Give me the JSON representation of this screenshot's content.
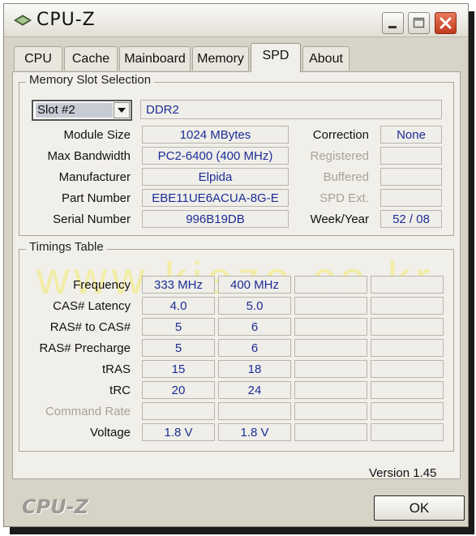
{
  "window": {
    "title": "CPU-Z",
    "controls": {
      "minimize": "minimize",
      "maximize": "maximize",
      "close": "close"
    }
  },
  "tabs": [
    {
      "label": "CPU"
    },
    {
      "label": "Cache"
    },
    {
      "label": "Mainboard"
    },
    {
      "label": "Memory"
    },
    {
      "label": "SPD",
      "active": true
    },
    {
      "label": "About"
    }
  ],
  "slot_selection": {
    "title": "Memory Slot Selection",
    "slot": "Slot #2",
    "type": "DDR2",
    "module_size_label": "Module Size",
    "module_size": "1024 MBytes",
    "max_bandwidth_label": "Max Bandwidth",
    "max_bandwidth": "PC2-6400 (400 MHz)",
    "manufacturer_label": "Manufacturer",
    "manufacturer": "Elpida",
    "part_number_label": "Part Number",
    "part_number": "EBE11UE6ACUA-8G-E",
    "serial_number_label": "Serial Number",
    "serial_number": "996B19DB",
    "correction_label": "Correction",
    "correction": "None",
    "registered_label": "Registered",
    "registered": "",
    "buffered_label": "Buffered",
    "buffered": "",
    "spd_ext_label": "SPD Ext.",
    "spd_ext": "",
    "week_year_label": "Week/Year",
    "week_year": "52 / 08"
  },
  "timings": {
    "title": "Timings Table",
    "rows": [
      {
        "label": "Frequency",
        "values": [
          "333 MHz",
          "400 MHz",
          "",
          ""
        ],
        "dim": false
      },
      {
        "label": "CAS# Latency",
        "values": [
          "4.0",
          "5.0",
          "",
          ""
        ],
        "dim": false
      },
      {
        "label": "RAS# to CAS#",
        "values": [
          "5",
          "6",
          "",
          ""
        ],
        "dim": false
      },
      {
        "label": "RAS# Precharge",
        "values": [
          "5",
          "6",
          "",
          ""
        ],
        "dim": false
      },
      {
        "label": "tRAS",
        "values": [
          "15",
          "18",
          "",
          ""
        ],
        "dim": false
      },
      {
        "label": "tRC",
        "values": [
          "20",
          "24",
          "",
          ""
        ],
        "dim": false
      },
      {
        "label": "Command Rate",
        "values": [
          "",
          "",
          "",
          ""
        ],
        "dim": true
      },
      {
        "label": "Voltage",
        "values": [
          "1.8 V",
          "1.8 V",
          "",
          ""
        ],
        "dim": false
      }
    ]
  },
  "watermark": "www.kieza.co.kr",
  "footer": {
    "version": "Version 1.45",
    "brand": "CPU-Z",
    "ok_label": "OK"
  },
  "colors": {
    "value_text": "#1c2d96",
    "frame": "#d7d3c7",
    "panel": "#f1efe9",
    "close_button": "#c9462a"
  },
  "icons": {
    "app": "cpu-z-diamond-icon",
    "minimize": "minimize-icon",
    "maximize": "maximize-icon",
    "close": "close-icon",
    "combo": "chevron-down-icon"
  }
}
